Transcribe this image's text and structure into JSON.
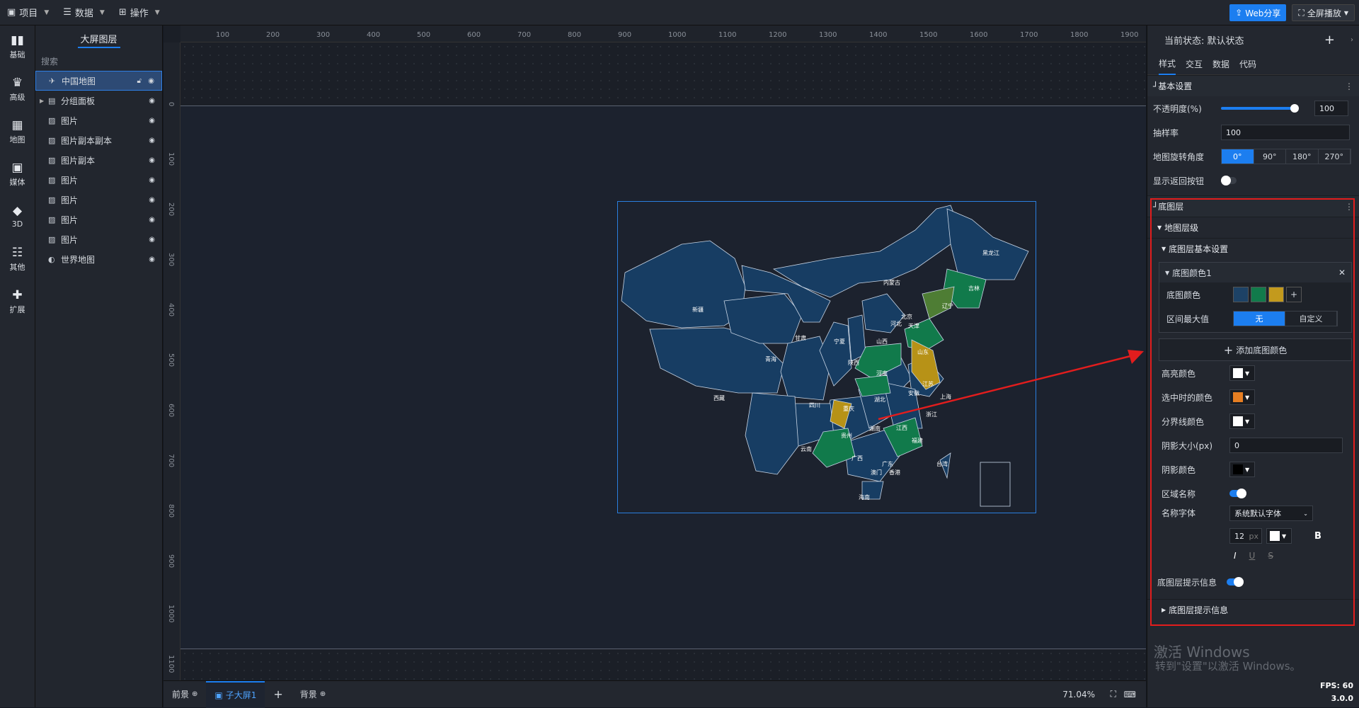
{
  "topbar": {
    "menus": [
      {
        "label": "项目",
        "icon": "project-icon"
      },
      {
        "label": "数据",
        "icon": "database-icon"
      },
      {
        "label": "操作",
        "icon": "grid-icon"
      }
    ],
    "web_share": "Web分享",
    "fullscreen": "全屏播放"
  },
  "sidebar": {
    "items": [
      "基础",
      "高级",
      "地图",
      "媒体",
      "3D",
      "其他",
      "扩展"
    ]
  },
  "layers": {
    "tab": "大屏图层",
    "search_placeholder": "搜索",
    "items": [
      "中国地图",
      "分组面板",
      "图片",
      "图片副本副本",
      "图片副本",
      "图片",
      "图片",
      "图片",
      "图片",
      "世界地图"
    ]
  },
  "rulers": {
    "h": [
      "100",
      "200",
      "300",
      "400",
      "500",
      "600",
      "700",
      "800",
      "900",
      "1000",
      "1100",
      "1200",
      "1300",
      "1400",
      "1500",
      "1600",
      "1700",
      "1800",
      "1900"
    ],
    "v": [
      "0",
      "100",
      "200",
      "300",
      "400",
      "500",
      "600",
      "700",
      "800",
      "900",
      "1000",
      "1100"
    ]
  },
  "map": {
    "regions": [
      "黑龙江",
      "吉林",
      "辽宁",
      "内蒙古",
      "新疆",
      "西藏",
      "青海",
      "甘肃",
      "宁夏",
      "陕西",
      "山西",
      "北京",
      "天津",
      "河北",
      "山东",
      "河南",
      "江苏",
      "安徽",
      "湖北",
      "四川",
      "重庆",
      "贵州",
      "湖南",
      "江西",
      "浙江",
      "上海",
      "福建",
      "云南",
      "广西",
      "广东",
      "澳门",
      "香港",
      "海南",
      "台湾"
    ]
  },
  "bottombar": {
    "front": "前景",
    "screen": "子大屏1",
    "background": "背景",
    "zoom": "71.04%"
  },
  "right": {
    "state_label": "当前状态:",
    "state_value": "默认状态",
    "tabs": [
      "样式",
      "交互",
      "数据",
      "代码"
    ],
    "basic": {
      "title": "基本设置",
      "opacity_label": "不透明度(%)",
      "opacity_value": "100",
      "opacity_level": 100,
      "sample_label": "抽样率",
      "sample_value": "100",
      "rotate_label": "地图旋转角度",
      "rotate_options": [
        "0°",
        "90°",
        "180°",
        "270°"
      ],
      "back_label": "显示返回按钮"
    },
    "base": {
      "title": "底图层",
      "level_title": "地图层级",
      "basic_title": "底图层基本设置",
      "color1_title": "底图颜色1",
      "base_color_label": "底图颜色",
      "base_colors": [
        "#1d4266",
        "#117a4b",
        "#c39a1d"
      ],
      "max_label": "区间最大值",
      "max_options": [
        "无",
        "自定义"
      ],
      "add_color": "添加底图颜色",
      "highlight_label": "高亮颜色",
      "highlight_color": "#ffffff",
      "selected_label": "选中时的颜色",
      "selected_color": "#e67e22",
      "border_label": "分界线颜色",
      "border_color": "#ffffff",
      "shadow_size_label": "阴影大小(px)",
      "shadow_size_value": "0",
      "shadow_color_label": "阴影颜色",
      "shadow_color": "#000000",
      "area_name_label": "区域名称",
      "font_label": "名称字体",
      "font_value": "系统默认字体",
      "font_size": "12",
      "font_unit": "px",
      "font_color": "#ffffff",
      "bold": "B",
      "italic": "I",
      "underline": "U",
      "strike": "S",
      "tip_label": "底图层提示信息",
      "tip_section": "底图层提示信息"
    },
    "watermark1": "激活 Windows",
    "watermark2": "转到\"设置\"以激活 Windows。",
    "fps": "FPS: 60",
    "version": "3.0.0"
  }
}
